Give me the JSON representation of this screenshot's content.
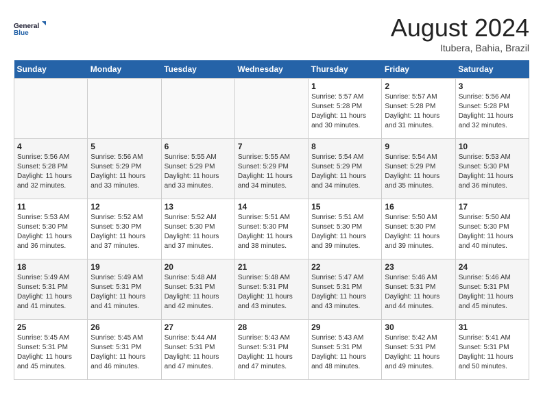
{
  "header": {
    "logo_line1": "General",
    "logo_line2": "Blue",
    "month_year": "August 2024",
    "location": "Itubera, Bahia, Brazil"
  },
  "weekdays": [
    "Sunday",
    "Monday",
    "Tuesday",
    "Wednesday",
    "Thursday",
    "Friday",
    "Saturday"
  ],
  "weeks": [
    [
      {
        "day": "",
        "info": ""
      },
      {
        "day": "",
        "info": ""
      },
      {
        "day": "",
        "info": ""
      },
      {
        "day": "",
        "info": ""
      },
      {
        "day": "1",
        "sunrise": "5:57 AM",
        "sunset": "5:28 PM",
        "daylight": "11 hours and 30 minutes."
      },
      {
        "day": "2",
        "sunrise": "5:57 AM",
        "sunset": "5:28 PM",
        "daylight": "11 hours and 31 minutes."
      },
      {
        "day": "3",
        "sunrise": "5:56 AM",
        "sunset": "5:28 PM",
        "daylight": "11 hours and 32 minutes."
      }
    ],
    [
      {
        "day": "4",
        "sunrise": "5:56 AM",
        "sunset": "5:28 PM",
        "daylight": "11 hours and 32 minutes."
      },
      {
        "day": "5",
        "sunrise": "5:56 AM",
        "sunset": "5:29 PM",
        "daylight": "11 hours and 33 minutes."
      },
      {
        "day": "6",
        "sunrise": "5:55 AM",
        "sunset": "5:29 PM",
        "daylight": "11 hours and 33 minutes."
      },
      {
        "day": "7",
        "sunrise": "5:55 AM",
        "sunset": "5:29 PM",
        "daylight": "11 hours and 34 minutes."
      },
      {
        "day": "8",
        "sunrise": "5:54 AM",
        "sunset": "5:29 PM",
        "daylight": "11 hours and 34 minutes."
      },
      {
        "day": "9",
        "sunrise": "5:54 AM",
        "sunset": "5:29 PM",
        "daylight": "11 hours and 35 minutes."
      },
      {
        "day": "10",
        "sunrise": "5:53 AM",
        "sunset": "5:30 PM",
        "daylight": "11 hours and 36 minutes."
      }
    ],
    [
      {
        "day": "11",
        "sunrise": "5:53 AM",
        "sunset": "5:30 PM",
        "daylight": "11 hours and 36 minutes."
      },
      {
        "day": "12",
        "sunrise": "5:52 AM",
        "sunset": "5:30 PM",
        "daylight": "11 hours and 37 minutes."
      },
      {
        "day": "13",
        "sunrise": "5:52 AM",
        "sunset": "5:30 PM",
        "daylight": "11 hours and 37 minutes."
      },
      {
        "day": "14",
        "sunrise": "5:51 AM",
        "sunset": "5:30 PM",
        "daylight": "11 hours and 38 minutes."
      },
      {
        "day": "15",
        "sunrise": "5:51 AM",
        "sunset": "5:30 PM",
        "daylight": "11 hours and 39 minutes."
      },
      {
        "day": "16",
        "sunrise": "5:50 AM",
        "sunset": "5:30 PM",
        "daylight": "11 hours and 39 minutes."
      },
      {
        "day": "17",
        "sunrise": "5:50 AM",
        "sunset": "5:30 PM",
        "daylight": "11 hours and 40 minutes."
      }
    ],
    [
      {
        "day": "18",
        "sunrise": "5:49 AM",
        "sunset": "5:31 PM",
        "daylight": "11 hours and 41 minutes."
      },
      {
        "day": "19",
        "sunrise": "5:49 AM",
        "sunset": "5:31 PM",
        "daylight": "11 hours and 41 minutes."
      },
      {
        "day": "20",
        "sunrise": "5:48 AM",
        "sunset": "5:31 PM",
        "daylight": "11 hours and 42 minutes."
      },
      {
        "day": "21",
        "sunrise": "5:48 AM",
        "sunset": "5:31 PM",
        "daylight": "11 hours and 43 minutes."
      },
      {
        "day": "22",
        "sunrise": "5:47 AM",
        "sunset": "5:31 PM",
        "daylight": "11 hours and 43 minutes."
      },
      {
        "day": "23",
        "sunrise": "5:46 AM",
        "sunset": "5:31 PM",
        "daylight": "11 hours and 44 minutes."
      },
      {
        "day": "24",
        "sunrise": "5:46 AM",
        "sunset": "5:31 PM",
        "daylight": "11 hours and 45 minutes."
      }
    ],
    [
      {
        "day": "25",
        "sunrise": "5:45 AM",
        "sunset": "5:31 PM",
        "daylight": "11 hours and 45 minutes."
      },
      {
        "day": "26",
        "sunrise": "5:45 AM",
        "sunset": "5:31 PM",
        "daylight": "11 hours and 46 minutes."
      },
      {
        "day": "27",
        "sunrise": "5:44 AM",
        "sunset": "5:31 PM",
        "daylight": "11 hours and 47 minutes."
      },
      {
        "day": "28",
        "sunrise": "5:43 AM",
        "sunset": "5:31 PM",
        "daylight": "11 hours and 47 minutes."
      },
      {
        "day": "29",
        "sunrise": "5:43 AM",
        "sunset": "5:31 PM",
        "daylight": "11 hours and 48 minutes."
      },
      {
        "day": "30",
        "sunrise": "5:42 AM",
        "sunset": "5:31 PM",
        "daylight": "11 hours and 49 minutes."
      },
      {
        "day": "31",
        "sunrise": "5:41 AM",
        "sunset": "5:31 PM",
        "daylight": "11 hours and 50 minutes."
      }
    ]
  ]
}
